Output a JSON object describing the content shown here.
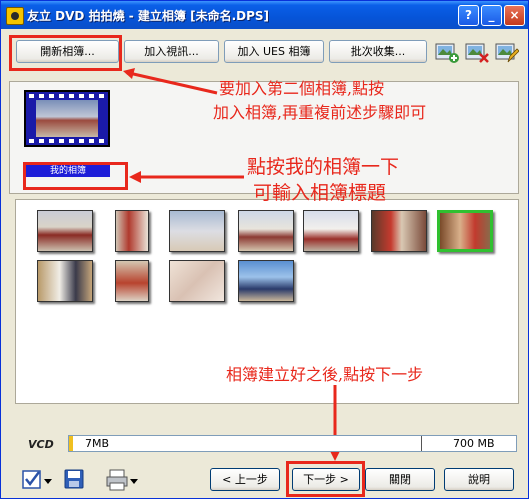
{
  "window": {
    "title": "友立 DVD 拍拍燒 - 建立相簿 [未命名.DPS]"
  },
  "toolbar": {
    "new_album_label": "開新相簿...",
    "add_video_label": "加入視訊...",
    "add_ues_label": "加入 UES 相簿",
    "batch_collect_label": "批次收集..."
  },
  "album": {
    "label": "我的相簿"
  },
  "annotations": {
    "add_album_line1": "要加入第二個相簿,點按",
    "add_album_line2": "加入相簿,再重複前述步驟即可",
    "title_line1": "點按我的相簿一下",
    "title_line2": "可輸入相簿標題",
    "next_hint": "相簿建立好之後,點按下一步"
  },
  "capacity": {
    "media_label": "VCD",
    "used_label": "7MB",
    "max_label": "700 MB",
    "used_fraction": 0.01
  },
  "nav": {
    "prev_label": "< 上一步",
    "next_label": "下一步 >",
    "close_label": "關閉",
    "help_label": "說明"
  },
  "colors": {
    "annotation_red": "#e8281c",
    "title_blue": "#0654d8",
    "album_label_blue": "#1d1dd8",
    "selected_green": "#30c030"
  }
}
